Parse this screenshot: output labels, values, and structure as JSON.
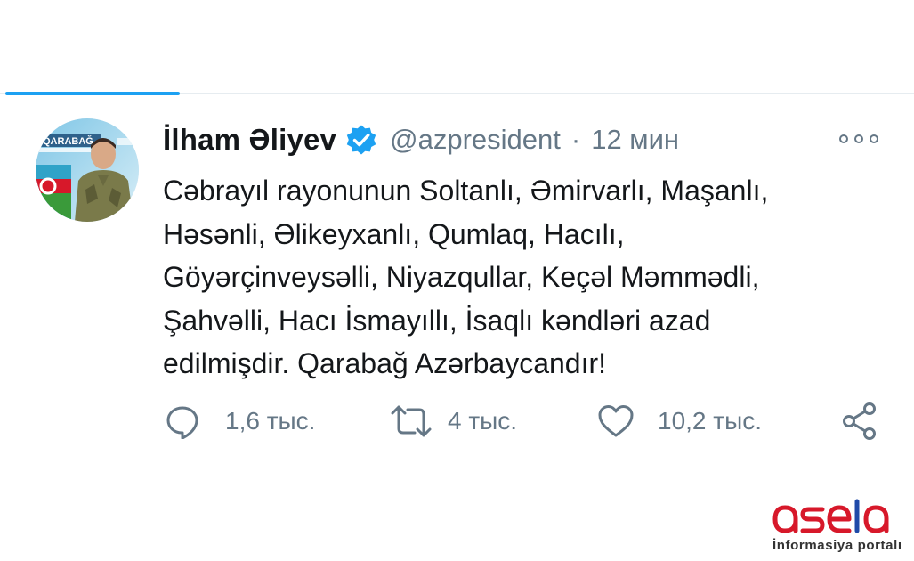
{
  "tweet": {
    "author": {
      "display_name": "İlham Əliyev",
      "handle": "@azpresident",
      "verified": true,
      "avatar_banner_text": "QARABAĞ"
    },
    "separator": "·",
    "time": "12 мин",
    "text_lines": [
      "Cəbrayıl rayonunun Soltanlı, Əmirvarlı, Maşanlı,",
      "Həsənli, Əlikeyxanlı, Qumlaq, Hacılı,",
      "Göyərçinveysəlli, Niyazqullar, Keçəl Məmmədli,",
      "Şahvəlli, Hacı İsmayıllı, İsaqlı kəndləri azad",
      "edilmişdir. Qarabağ Azərbaycandır!"
    ],
    "actions": {
      "reply_count": "1,6 тыс.",
      "retweet_count": "4 тыс.",
      "like_count": "10,2 тыс."
    }
  },
  "icons": {
    "verified": "verified-badge-icon",
    "more": "more-options-icon",
    "reply": "reply-icon",
    "retweet": "retweet-icon",
    "like": "heart-icon",
    "share": "share-icon"
  },
  "watermark": {
    "brand": "asela",
    "tagline": "İnformasiya portalı"
  },
  "colors": {
    "accent": "#1da1f2",
    "text": "#14171a",
    "muted": "#657786",
    "logo_red": "#d7182a"
  }
}
